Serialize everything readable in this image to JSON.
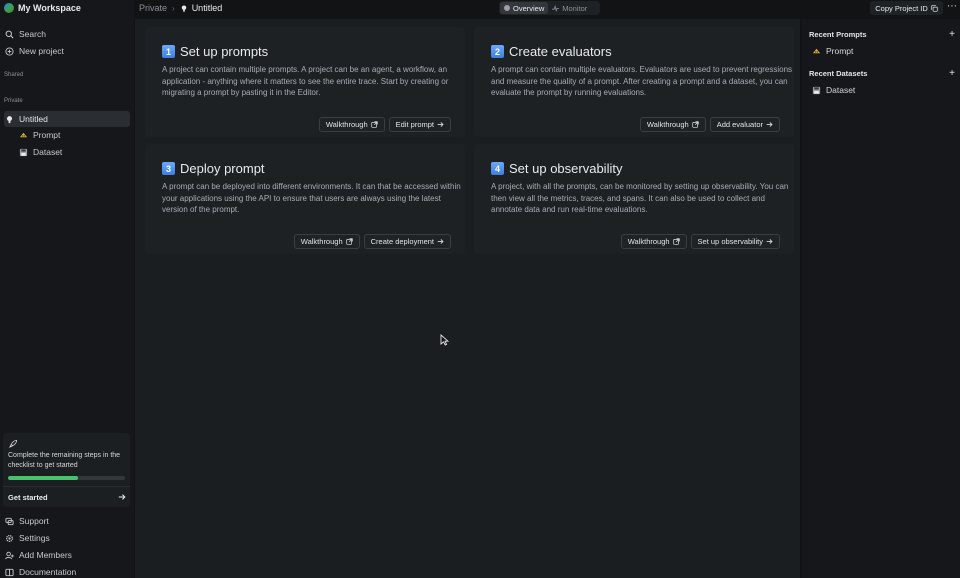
{
  "workspace": {
    "title": "My Workspace"
  },
  "sidebar": {
    "search": "Search",
    "new_project": "New project",
    "shared_label": "Shared",
    "private_label": "Private",
    "project": "Untitled",
    "children": [
      "Prompt",
      "Dataset"
    ],
    "footer": [
      "Support",
      "Settings",
      "Add Members",
      "Documentation"
    ]
  },
  "checklist": {
    "message": "Complete the remaining steps in the checklist to get started",
    "cta": "Get started",
    "progress_percent": 60,
    "progress_color": "#45c46b"
  },
  "topbar": {
    "breadcrumb_root": "Private",
    "breadcrumb_current": "Untitled",
    "view_options": [
      "Overview",
      "Monitor"
    ],
    "selected_view": "Overview",
    "copy_button": "Copy Project ID"
  },
  "cards": [
    {
      "number": "1",
      "title": "Set up prompts",
      "text": "A project can contain multiple prompts. A project can be an agent, a workflow, an application - anything where it matters to see the entire trace. Start by creating or migrating a prompt by pasting it in the Editor.",
      "secondary": "Walkthrough",
      "primary": "Edit prompt"
    },
    {
      "number": "2",
      "title": "Create evaluators",
      "text": "A prompt can contain multiple evaluators. Evaluators are used to prevent regressions and measure the quality of a prompt. After creating a prompt and a dataset, you can evaluate the prompt by running evaluations.",
      "secondary": "Walkthrough",
      "primary": "Add evaluator"
    },
    {
      "number": "3",
      "title": "Deploy prompt",
      "text": "A prompt can be deployed into different environments. It can that be accessed within your applications using the API to ensure that users are always using the latest version of the prompt.",
      "secondary": "Walkthrough",
      "primary": "Create deployment"
    },
    {
      "number": "4",
      "title": "Set up observability",
      "text": "A project, with all the prompts, can be monitored by setting up observability. You can then view all the metrics, traces, and spans. It can also be used to collect and annotate data and run real-time evaluations.",
      "secondary": "Walkthrough",
      "primary": "Set up observability"
    }
  ],
  "right_panel": {
    "recent_prompts_label": "Recent Prompts",
    "recent_prompts": [
      "Prompt"
    ],
    "recent_datasets_label": "Recent Datasets",
    "recent_datasets": [
      "Dataset"
    ]
  },
  "colors": {
    "accent": "#3d7fe0",
    "background": "#111315",
    "panel": "#1e2123"
  },
  "icons": [
    "search-icon",
    "plus-circle-icon",
    "bulb-icon",
    "prompt-icon",
    "dataset-icon",
    "rocket-icon",
    "arrow-right-icon",
    "external-link-icon",
    "life-ring-icon",
    "gear-icon",
    "user-plus-icon",
    "book-icon",
    "copy-icon",
    "more-icon",
    "plus-icon",
    "pulse-icon"
  ]
}
